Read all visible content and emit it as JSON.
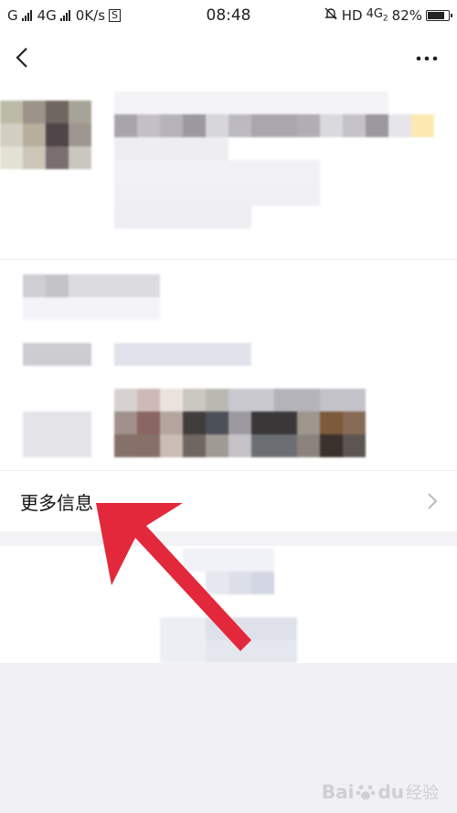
{
  "status_bar": {
    "carrier_left": "G",
    "network": "4G",
    "speed": "0K/s",
    "s_badge": "S",
    "time": "08:48",
    "hd": "HD",
    "network_right": "4G",
    "network_right_sub": "2",
    "battery_text": "82%",
    "battery_level": 82
  },
  "toolbar": {
    "back_icon": "chevron-left-icon",
    "more_icon": "more-dots-icon"
  },
  "more_info": {
    "label": "更多信息",
    "chevron_icon": "chevron-right-icon"
  },
  "annotation": {
    "arrow_color": "#e3283c"
  },
  "watermark": {
    "brand": "Bai",
    "brand_suffix": "du",
    "sub": "经验"
  }
}
